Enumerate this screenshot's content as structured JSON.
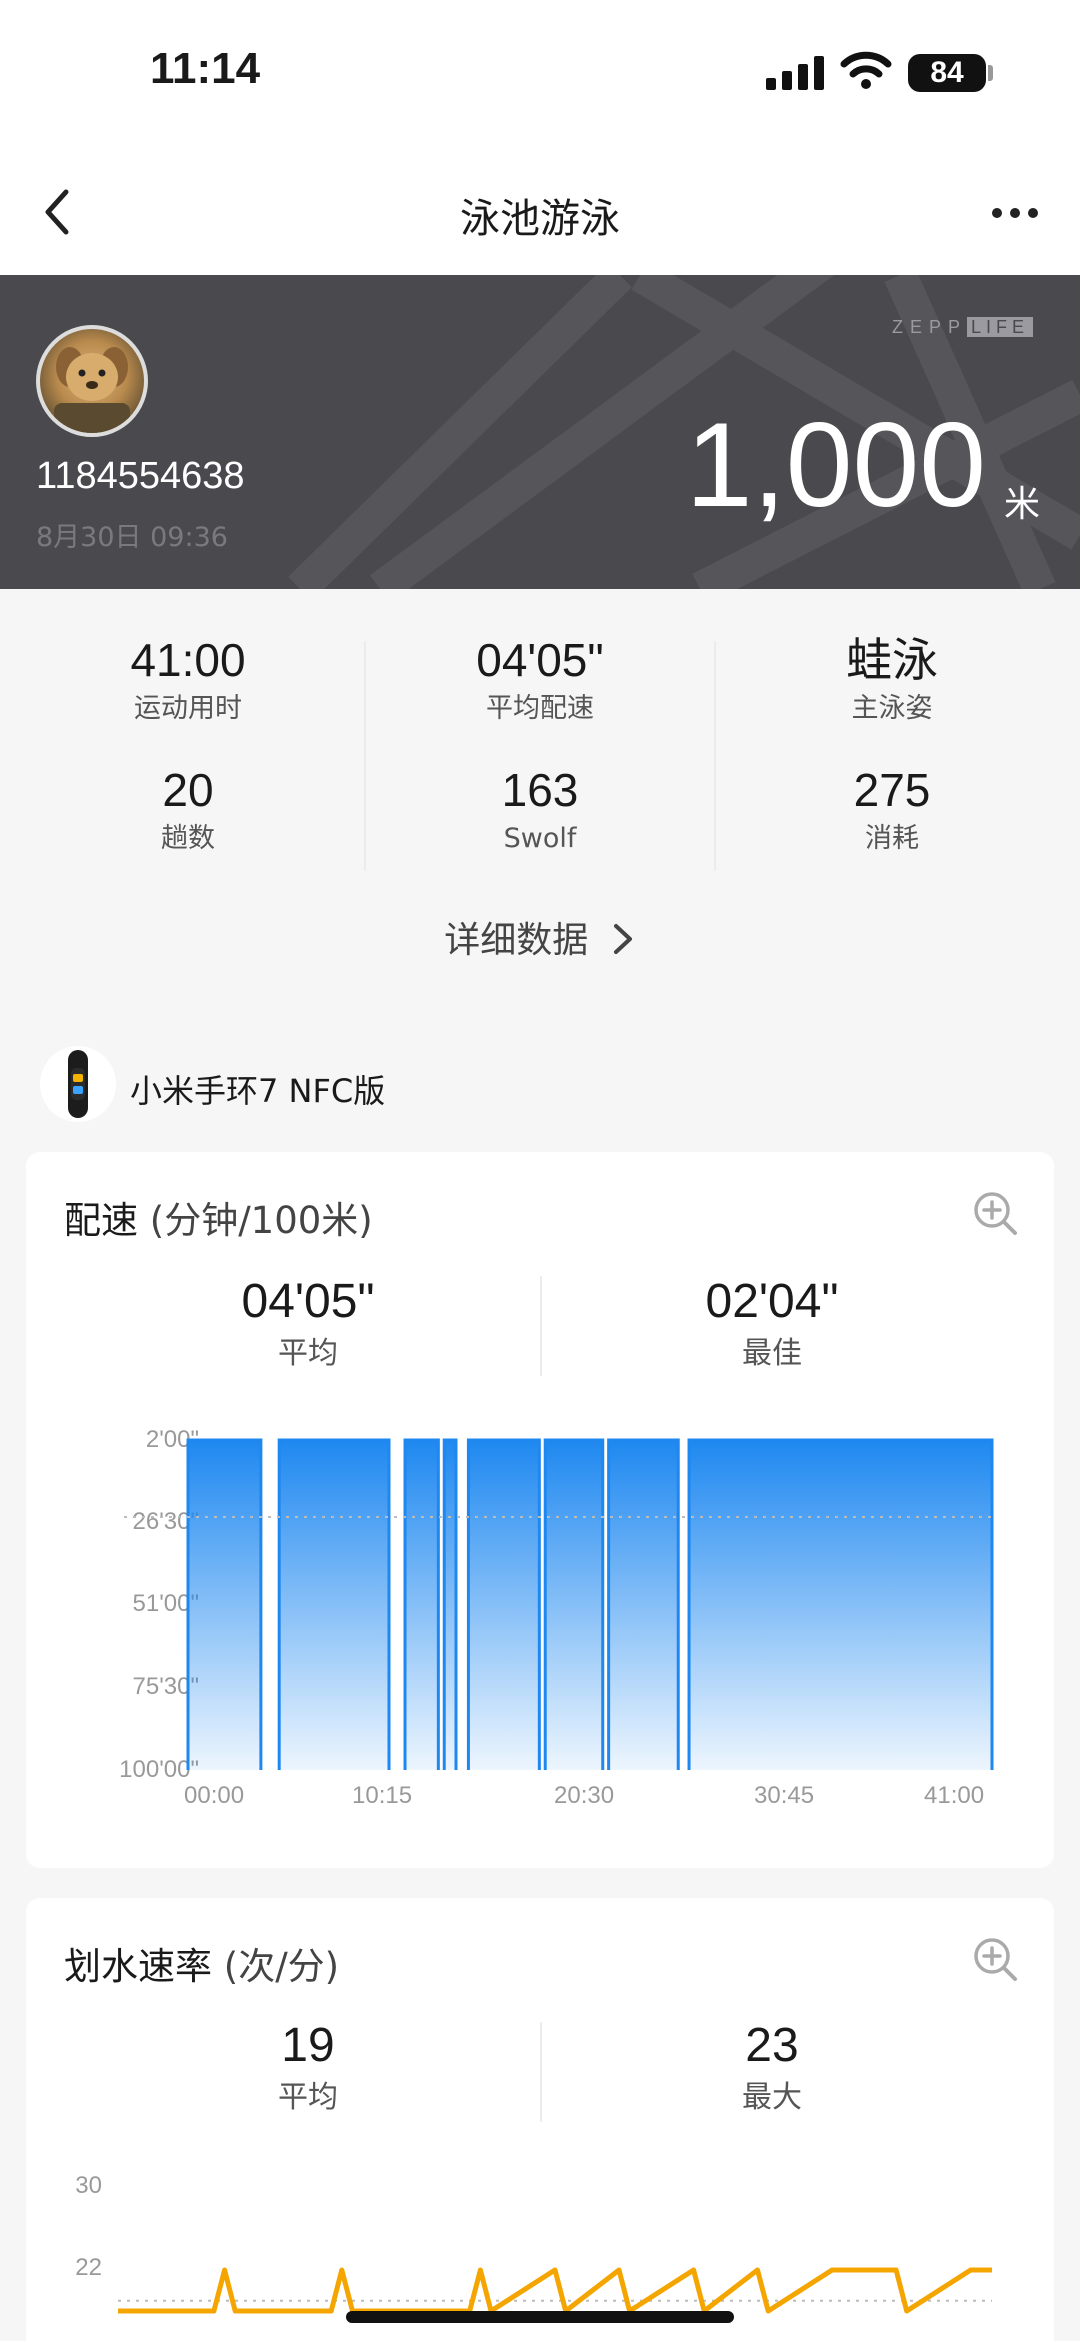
{
  "status_bar": {
    "time": "11:14",
    "battery": "84"
  },
  "nav": {
    "title": "泳池游泳"
  },
  "header": {
    "user_id": "1184554638",
    "date": "8月30日 09:36",
    "brand_zepp": "ZEPP",
    "brand_life": "LIFE",
    "distance": "1,000",
    "distance_unit": "米"
  },
  "summary": {
    "stats": [
      {
        "value": "41:00",
        "label": "运动用时"
      },
      {
        "value": "04'05\"",
        "label": "平均配速"
      },
      {
        "value": "蛙泳",
        "label": "主泳姿"
      },
      {
        "value": "20",
        "label": "趟数"
      },
      {
        "value": "163",
        "label": "Swolf"
      },
      {
        "value": "275",
        "label": "消耗"
      }
    ],
    "detail_link": "详细数据"
  },
  "device": {
    "name": "小米手环7 NFC版"
  },
  "pace_card": {
    "title": "配速",
    "unit": "(分钟/100米)",
    "avg_value": "04'05\"",
    "avg_label": "平均",
    "best_value": "02'04\"",
    "best_label": "最佳"
  },
  "stroke_card": {
    "title": "划水速率",
    "unit": "(次/分)",
    "avg_value": "19",
    "avg_label": "平均",
    "max_value": "23",
    "max_label": "最大"
  },
  "chart_data": [
    {
      "type": "area",
      "title": "配速 (分钟/100米)",
      "x_ticks": [
        "00:00",
        "10:15",
        "20:30",
        "30:45",
        "41:00"
      ],
      "y_ticks": [
        "2'00\"",
        "26'30\"",
        "51'00\"",
        "75'30\"",
        "100'00\""
      ],
      "y_reversed": true,
      "xlim": [
        "00:00",
        "41:00"
      ],
      "ylim": [
        "2'00\"",
        "100'00\""
      ],
      "average_line": "04'05\"",
      "color": "#1e88f0",
      "series": [
        {
          "segments": [
            {
              "start": "00:00",
              "end": "03:43",
              "pace": "2'00\""
            },
            {
              "start": "04:39",
              "end": "10:15",
              "pace": "2'00\""
            },
            {
              "start": "11:04",
              "end": "12:46",
              "pace": "2'00\""
            },
            {
              "start": "13:04",
              "end": "13:40",
              "pace": "2'00\""
            },
            {
              "start": "14:18",
              "end": "17:55",
              "pace": "2'00\""
            },
            {
              "start": "18:13",
              "end": "21:09",
              "pace": "2'00\""
            },
            {
              "start": "21:27",
              "end": "25:00",
              "pace": "2'00\""
            },
            {
              "start": "25:33",
              "end": "41:00",
              "pace": "2'00\""
            }
          ]
        }
      ]
    },
    {
      "type": "line",
      "title": "划水速率 (次/分)",
      "y_ticks": [
        "30",
        "22"
      ],
      "average_line": 19,
      "color": "#f5a500",
      "series": [
        {
          "points": [
            {
              "x": "00:00",
              "y": 18
            },
            {
              "x": "04:30",
              "y": 18
            },
            {
              "x": "05:00",
              "y": 22
            },
            {
              "x": "05:30",
              "y": 18
            },
            {
              "x": "10:00",
              "y": 18
            },
            {
              "x": "10:30",
              "y": 22
            },
            {
              "x": "11:00",
              "y": 18
            },
            {
              "x": "16:30",
              "y": 18
            },
            {
              "x": "17:00",
              "y": 22
            },
            {
              "x": "17:30",
              "y": 18
            },
            {
              "x": "20:30",
              "y": 22
            },
            {
              "x": "21:00",
              "y": 18
            },
            {
              "x": "23:30",
              "y": 22
            },
            {
              "x": "24:00",
              "y": 18
            },
            {
              "x": "27:00",
              "y": 22
            },
            {
              "x": "27:30",
              "y": 18
            },
            {
              "x": "30:00",
              "y": 22
            },
            {
              "x": "30:30",
              "y": 18
            },
            {
              "x": "33:30",
              "y": 22
            },
            {
              "x": "36:30",
              "y": 22
            },
            {
              "x": "37:00",
              "y": 18
            },
            {
              "x": "40:00",
              "y": 22
            },
            {
              "x": "41:00",
              "y": 22
            }
          ]
        }
      ]
    }
  ],
  "colors": {
    "pace": "#1e88f0",
    "stroke": "#f5a500",
    "banner": "#4a4a4e"
  }
}
